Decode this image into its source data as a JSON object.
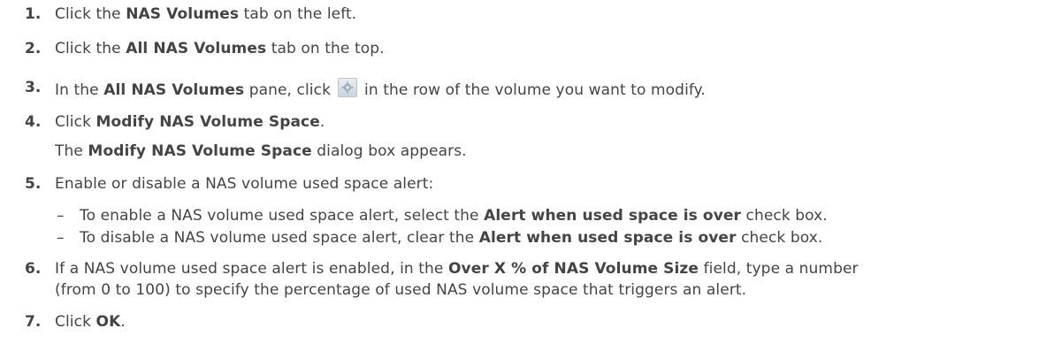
{
  "steps": [
    {
      "num": "1.",
      "pre": "Click the ",
      "b1": "NAS Volumes",
      "post": " tab on the left."
    },
    {
      "num": "2.",
      "pre": "Click the ",
      "b1": "All NAS Volumes",
      "post": " tab on the top."
    },
    {
      "num": "3.",
      "pre": "In the ",
      "b1": "All NAS Volumes",
      "mid": " pane, click ",
      "post": " in the row of the volume you want to modify.",
      "icon": "gear-icon"
    },
    {
      "num": "4.",
      "pre": "Click ",
      "b1": "Modify NAS Volume Space",
      "post": "."
    },
    {
      "num": "5.",
      "text": "Enable or disable a NAS volume used space alert:"
    },
    {
      "num": "6.",
      "pre": "If a NAS volume used space alert is enabled, in the ",
      "b1": "Over X % of NAS Volume Size",
      "post": " field, type a number",
      "cont": "(from 0 to 100) to specify the percentage of used NAS volume space that triggers an alert."
    },
    {
      "num": "7.",
      "pre": "Click ",
      "b1": "OK",
      "post": "."
    }
  ],
  "step4_sub": {
    "pre": "The ",
    "b1": "Modify NAS Volume Space",
    "post": " dialog box appears."
  },
  "bullets": [
    {
      "dash": "–",
      "pre": "To enable a NAS volume used space alert, select the ",
      "b1": "Alert when used space is over",
      "post": " check box."
    },
    {
      "dash": "–",
      "pre": "To disable a NAS volume used space alert, clear the ",
      "b1": "Alert when used space is over",
      "post": " check box."
    }
  ]
}
